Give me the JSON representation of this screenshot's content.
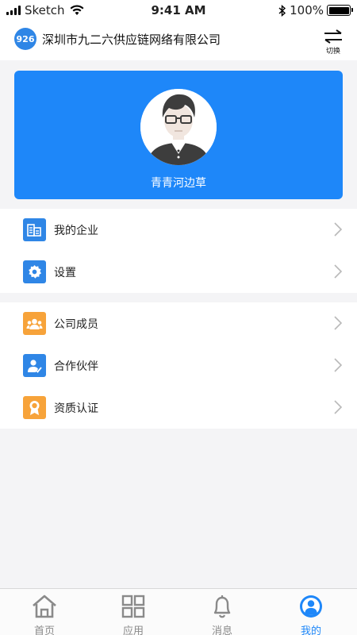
{
  "status_bar": {
    "carrier": "Sketch",
    "time": "9:41 AM",
    "battery": "100%"
  },
  "header": {
    "logo_text": "926",
    "company": "深圳市九二六供应链网络有限公司",
    "switch_label": "切换"
  },
  "profile": {
    "name": "青青河边草"
  },
  "menu_group_1": [
    {
      "label": "我的企业",
      "icon": "building-icon"
    },
    {
      "label": "设置",
      "icon": "gear-icon"
    }
  ],
  "menu_group_2": [
    {
      "label": "公司成员",
      "icon": "members-icon"
    },
    {
      "label": "合作伙伴",
      "icon": "partner-icon"
    },
    {
      "label": "资质认证",
      "icon": "certificate-icon"
    }
  ],
  "tabs": [
    {
      "label": "首页",
      "icon": "home-icon"
    },
    {
      "label": "应用",
      "icon": "apps-icon"
    },
    {
      "label": "消息",
      "icon": "bell-icon"
    },
    {
      "label": "我的",
      "icon": "profile-icon",
      "active": true
    }
  ],
  "colors": {
    "primary": "#1e87f9",
    "orange": "#f7a33a",
    "blue_icon": "#2f86e6"
  }
}
